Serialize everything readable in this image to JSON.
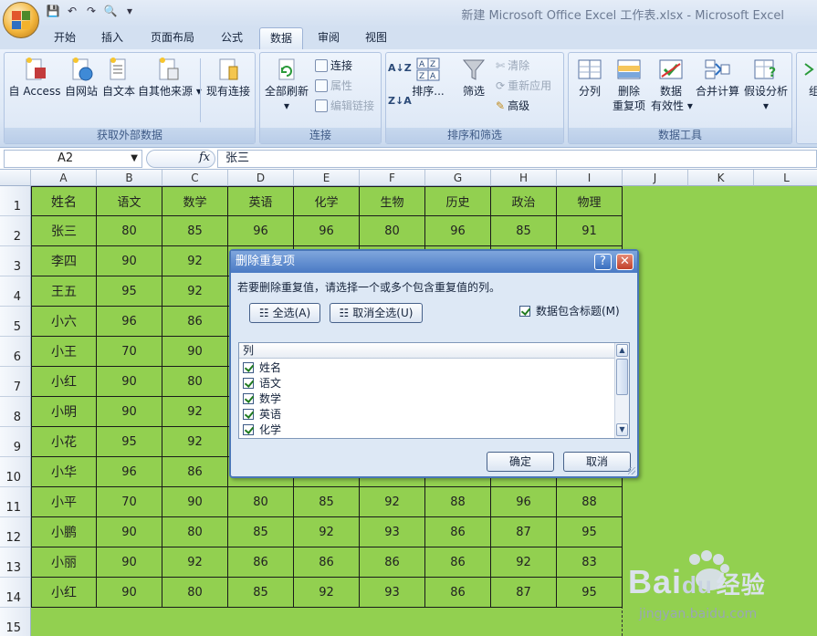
{
  "window": {
    "title": "新建 Microsoft Office Excel 工作表.xlsx - Microsoft Excel"
  },
  "qat": {
    "save": "💾",
    "undo": "↶",
    "redo": "↷",
    "preview": "🔍",
    "more": "▾"
  },
  "tabs": [
    "开始",
    "插入",
    "页面布局",
    "公式",
    "数据",
    "审阅",
    "视图"
  ],
  "active_tab": "数据",
  "ribbon": {
    "get_external": {
      "label": "获取外部数据",
      "access": "自 Access",
      "web": "自网站",
      "text": "自文本",
      "other": "自其他来源",
      "existing": "现有连接"
    },
    "connections": {
      "label": "连接",
      "refresh_all": "全部刷新",
      "connections": "连接",
      "properties": "属性",
      "edit_links": "编辑链接"
    },
    "sort_filter": {
      "label": "排序和筛选",
      "sort": "排序...",
      "filter": "筛选",
      "clear": "清除",
      "reapply": "重新应用",
      "advanced": "高级"
    },
    "data_tools": {
      "label": "数据工具",
      "split": "分列",
      "remove_dup_1": "删除",
      "remove_dup_2": "重复项",
      "validation_1": "数据",
      "validation_2": "有效性",
      "consolidate": "合并计算",
      "whatif": "假设分析"
    },
    "extra": "组"
  },
  "formula_bar": {
    "name_box": "A2",
    "fx": "fx",
    "value": "张三"
  },
  "columns": [
    "A",
    "B",
    "C",
    "D",
    "E",
    "F",
    "G",
    "H",
    "I",
    "J",
    "K",
    "L"
  ],
  "rows": [
    "1",
    "2",
    "3",
    "4",
    "5",
    "6",
    "7",
    "8",
    "9",
    "10",
    "11",
    "12",
    "13",
    "14",
    "15"
  ],
  "table": {
    "header": [
      "姓名",
      "语文",
      "数学",
      "英语",
      "化学",
      "生物",
      "历史",
      "政治",
      "物理"
    ],
    "rows": [
      [
        "张三",
        "80",
        "85",
        "96",
        "96",
        "80",
        "96",
        "85",
        "91"
      ],
      [
        "李四",
        "90",
        "92",
        "",
        "",
        "",
        "",
        "",
        ""
      ],
      [
        "王五",
        "95",
        "92",
        "",
        "",
        "",
        "",
        "",
        ""
      ],
      [
        "小六",
        "96",
        "86",
        "",
        "",
        "",
        "",
        "",
        ""
      ],
      [
        "小王",
        "70",
        "90",
        "",
        "",
        "",
        "",
        "",
        ""
      ],
      [
        "小红",
        "90",
        "80",
        "",
        "",
        "",
        "",
        "",
        ""
      ],
      [
        "小明",
        "90",
        "92",
        "",
        "",
        "",
        "",
        "",
        ""
      ],
      [
        "小花",
        "95",
        "92",
        "",
        "",
        "",
        "",
        "",
        ""
      ],
      [
        "小华",
        "96",
        "86",
        "",
        "",
        "",
        "",
        "",
        ""
      ],
      [
        "小平",
        "70",
        "90",
        "80",
        "85",
        "92",
        "88",
        "96",
        "88"
      ],
      [
        "小鹏",
        "90",
        "80",
        "85",
        "92",
        "93",
        "86",
        "87",
        "95"
      ],
      [
        "小丽",
        "90",
        "92",
        "86",
        "86",
        "86",
        "86",
        "92",
        "83"
      ],
      [
        "小红",
        "90",
        "80",
        "85",
        "92",
        "93",
        "86",
        "87",
        "95"
      ]
    ]
  },
  "dialog": {
    "title": "删除重复项",
    "help": "?",
    "close": "✕",
    "instruction": "若要删除重复值，请选择一个或多个包含重复值的列。",
    "select_all": "全选(A)",
    "unselect_all": "取消全选(U)",
    "has_headers": "数据包含标题(M)",
    "list_header": "列",
    "columns": [
      "姓名",
      "语文",
      "数学",
      "英语",
      "化学"
    ],
    "ok": "确定",
    "cancel": "取消"
  },
  "watermark": {
    "brand": "Bai",
    "brand2": "du",
    "tag": "经验",
    "url": "jingyan.baidu.com"
  }
}
